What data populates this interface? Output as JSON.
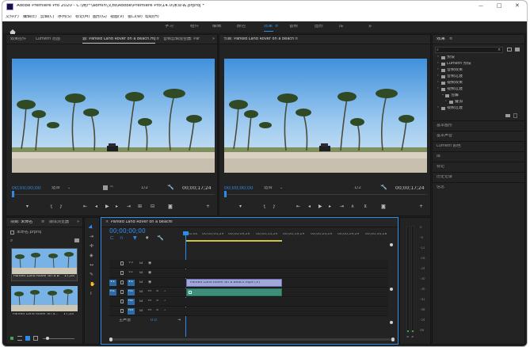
{
  "title": "Adobe Premiere Pro 2020 - C:\\用户\\admin\\文档\\Adobe\\Premiere Pro\\14.0\\未命名.prproj *",
  "window_controls": {
    "min": "—",
    "max": "□",
    "close": "✕"
  },
  "menu": [
    "文件(F)",
    "编辑(E)",
    "剪辑(C)",
    "序列(S)",
    "标记(M)",
    "图形(G)",
    "视图(V)",
    "窗口(W)",
    "帮助(H)"
  ],
  "workspaces": [
    "学习",
    "组件",
    "编辑",
    "颜色",
    "效果",
    "音频",
    "图形",
    "库"
  ],
  "active_workspace": "效果",
  "workspace_more": "»",
  "source_tabs": [
    "效果控件",
    "Lumetri 范围",
    "源: Parked Land Rover on a beach.mp4",
    "音频剪辑混合器: Par"
  ],
  "source_tab_more": "»",
  "source_time": "00;00;00;00",
  "source_fit": "适合",
  "source_res": "1/2",
  "source_duration": "00;00;17;24",
  "program_tab": "节目: Parked Land Rover on a beach",
  "program_time": "00;00;00;00",
  "program_fit": "适合",
  "program_res": "1/2",
  "program_duration": "00;00;17;24",
  "project_tabs": [
    "项目: 未命名",
    "媒体浏览器"
  ],
  "project_more": "»",
  "project_file": "未命名.prproj",
  "clips": [
    {
      "name": "Parked Land Rover on a beach",
      "duration": "17;24"
    },
    {
      "name": "Parked Land Rover on a...",
      "duration": "17;24"
    }
  ],
  "timeline_tab": "Parked Land Rover on a beach",
  "timeline_time": "00;00;00;00",
  "ruler": [
    ";00;00",
    "00;00;04;29",
    "00;00;09;29",
    "00;00;14;29",
    "00;00;19;29",
    "00;00;24;29",
    "00;00;29;29",
    "00;00;34;28"
  ],
  "video_tracks": [
    "V3",
    "V2",
    "V1"
  ],
  "audio_tracks": [
    "A1",
    "A2",
    "A3"
  ],
  "master_track": "主声道",
  "master_value": "0.0",
  "clip_label": "Parked Land Rover on a beach.mp4 [V]",
  "meter_scale": [
    "0",
    "-6",
    "-12",
    "-18",
    "-24",
    "-30",
    "-36",
    "-42",
    "-48",
    "-54",
    "dB"
  ],
  "meter_solo": [
    "S",
    "S"
  ],
  "effects_tab": "效果",
  "effects_more": "≡",
  "effects_search_placeholder": "",
  "effects_tree": [
    {
      "label": "预设",
      "level": 0,
      "open": false
    },
    {
      "label": "Lumetri 预设",
      "level": 0,
      "open": false
    },
    {
      "label": "音频效果",
      "level": 0,
      "open": false
    },
    {
      "label": "音频过渡",
      "level": 0,
      "open": false
    },
    {
      "label": "视频效果",
      "level": 0,
      "open": false
    },
    {
      "label": "视频过渡",
      "level": 0,
      "open": false
    },
    {
      "label": "溶解",
      "level": 1,
      "open": true
    },
    {
      "label": "叠加",
      "level": 2,
      "open": false
    },
    {
      "label": "视频过渡",
      "level": 0,
      "open": false
    }
  ],
  "right_sections": [
    "基本图形",
    "基本声音",
    "Lumetri 颜色",
    "库",
    "标记",
    "历史记录",
    "信息"
  ]
}
